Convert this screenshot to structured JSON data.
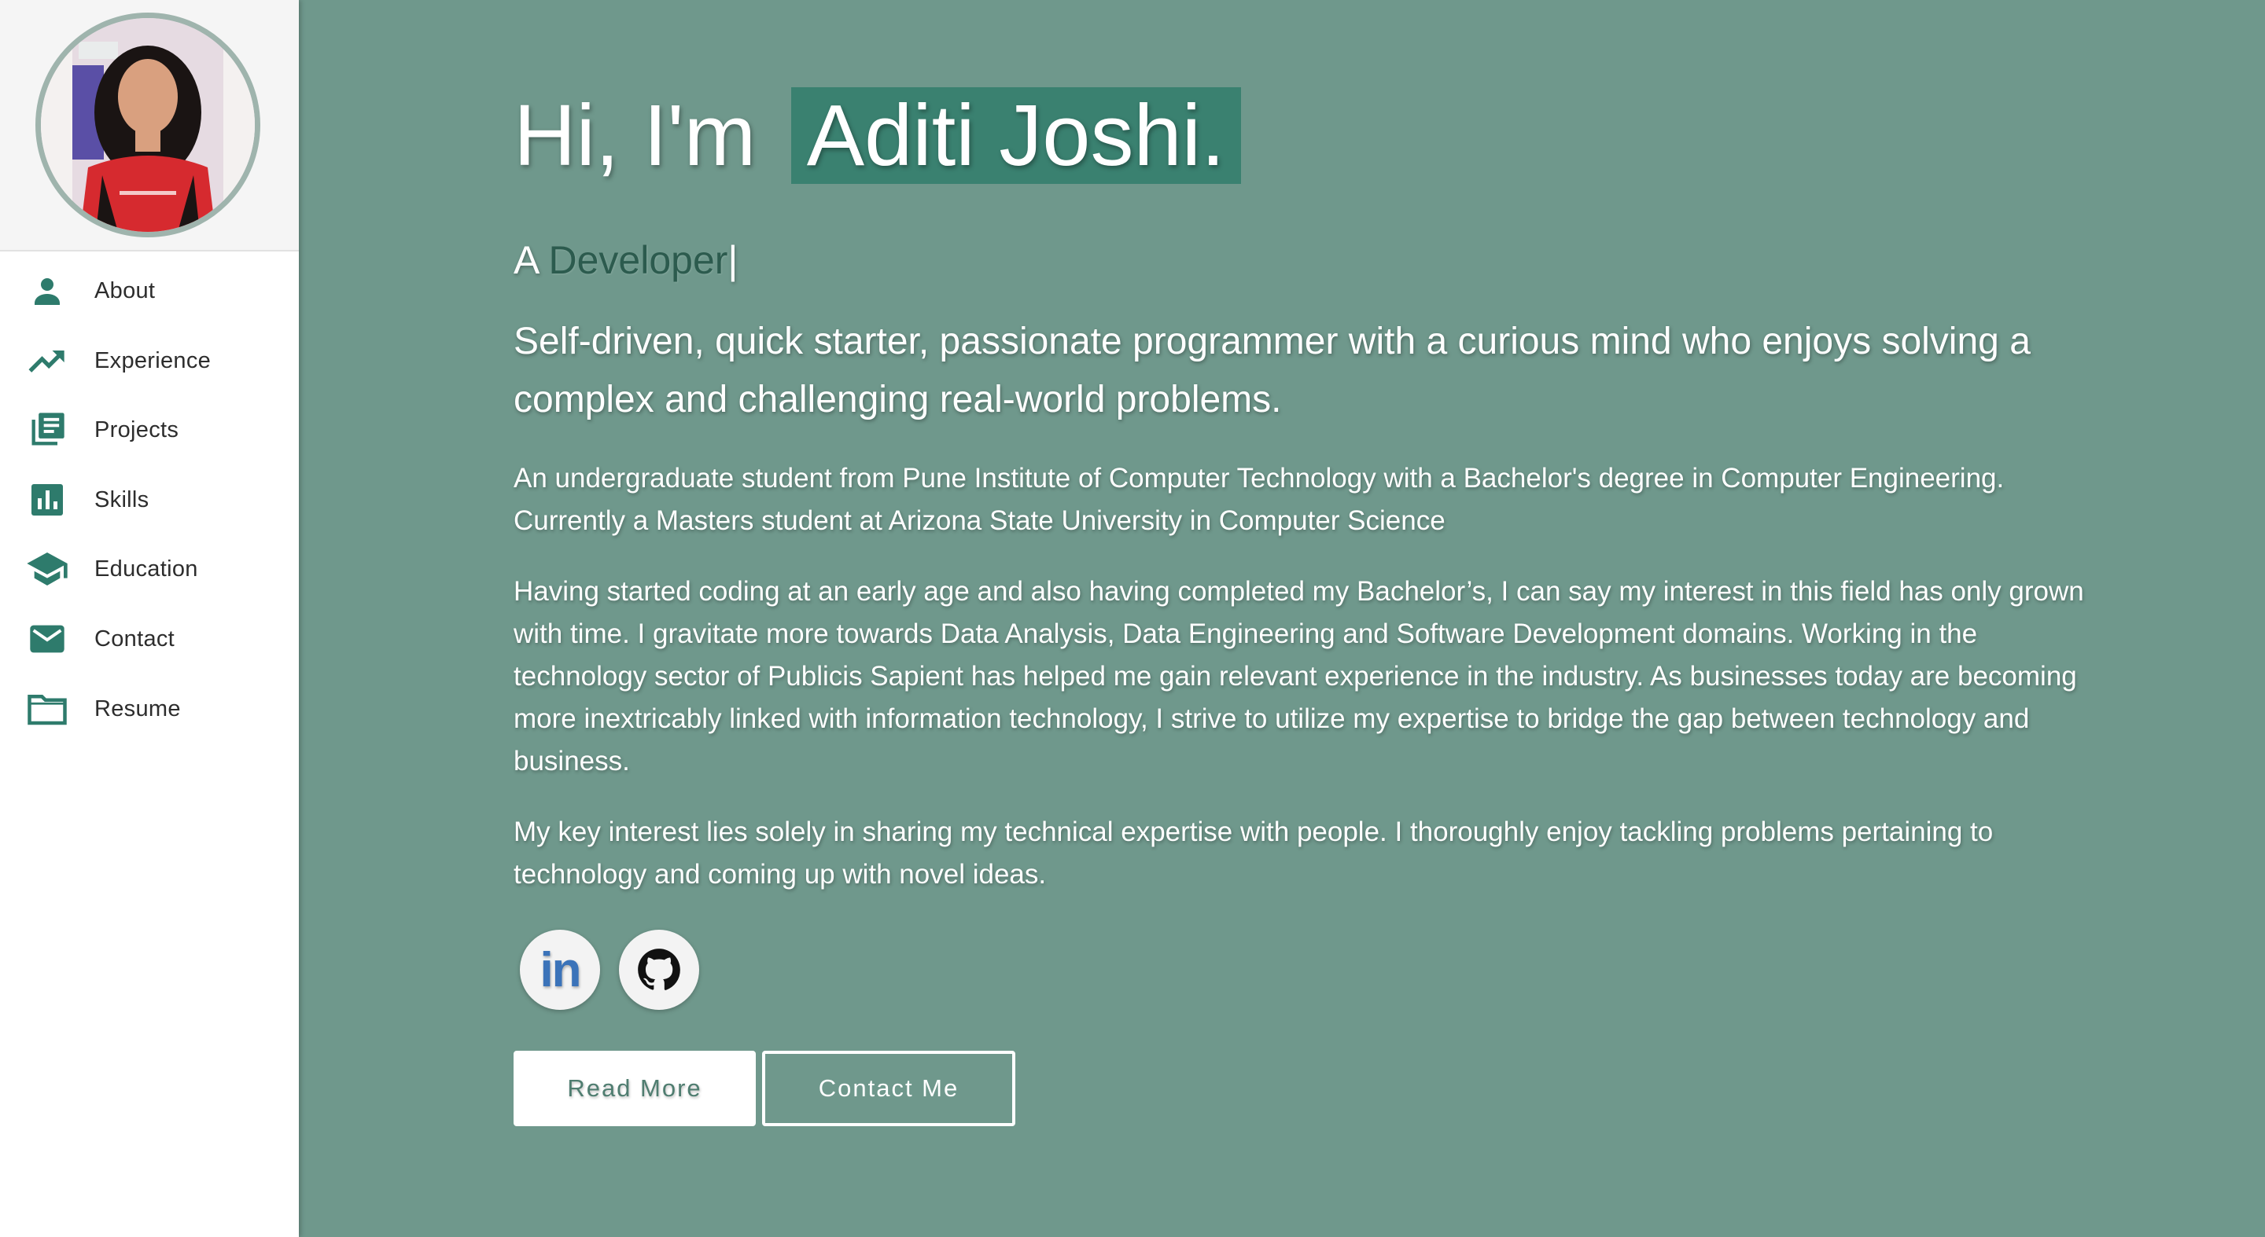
{
  "sidebar": {
    "items": [
      {
        "label": "About",
        "icon": "person-icon"
      },
      {
        "label": "Experience",
        "icon": "trending-up-icon"
      },
      {
        "label": "Projects",
        "icon": "library-books-icon"
      },
      {
        "label": "Skills",
        "icon": "bar-chart-icon"
      },
      {
        "label": "Education",
        "icon": "graduation-cap-icon"
      },
      {
        "label": "Contact",
        "icon": "mail-icon"
      },
      {
        "label": "Resume",
        "icon": "folder-icon"
      }
    ]
  },
  "hero": {
    "greeting": "Hi, I'm",
    "name": "Aditi Joshi.",
    "role_prefix": "A",
    "role_word": "Developer",
    "cursor": "|",
    "tagline": "Self-driven, quick starter, passionate programmer with a curious mind who enjoys solving a complex and challenging real-world problems.",
    "paragraphs": [
      "An undergraduate student from Pune Institute of Computer Technology with a Bachelor's degree in Computer Engineering. Currently a Masters student at Arizona State University in Computer Science",
      "Having started coding at an early age and also having completed my Bachelor’s, I can say my interest in this field has only grown with time. I gravitate more towards Data Analysis, Data Engineering and Software Development domains. Working in the technology sector of Publicis Sapient has helped me gain relevant experience in the industry. As businesses today are becoming more inextricably linked with information technology, I strive to utilize my expertise to bridge the gap between technology and business.",
      "My key interest lies solely in sharing my technical expertise with people. I thoroughly enjoy tackling problems pertaining to technology and coming up with novel ideas."
    ]
  },
  "socials": {
    "linkedin_label": "in"
  },
  "buttons": {
    "read_more": "Read More",
    "contact_me": "Contact Me"
  },
  "colors": {
    "background": "#6f988c",
    "accent": "#2e7b6c",
    "name_highlight": "#3a8170",
    "linkedin_blue": "#3b73b9"
  }
}
